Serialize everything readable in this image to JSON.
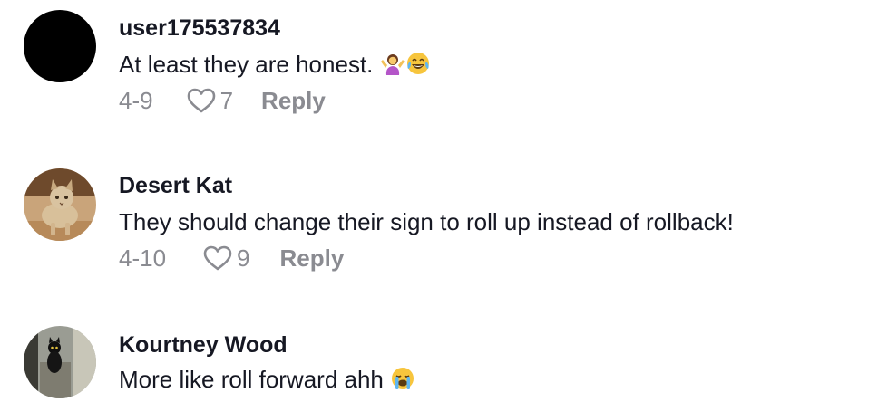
{
  "comments": [
    {
      "username": "user175537834",
      "text": "At least they are honest.",
      "emojis": [
        "woman-shrugging-emoji",
        "tears-of-joy-emoji"
      ],
      "date": "4-9",
      "likes": "7",
      "reply_label": "Reply",
      "avatar": "black-circle-avatar"
    },
    {
      "username": "Desert Kat",
      "text": "They should change their sign to roll up instead of rollback!",
      "date": "4-10",
      "likes": "9",
      "reply_label": "Reply",
      "avatar": "sand-cat-photo-avatar"
    },
    {
      "username": "Kourtney Wood",
      "text": "More like roll forward ahh",
      "emojis": [
        "loudly-crying-emoji"
      ],
      "avatar": "black-cat-photo-avatar"
    }
  ],
  "colors": {
    "username": "#161823",
    "text": "#161823",
    "meta": "#8a8b91",
    "background": "#ffffff"
  }
}
